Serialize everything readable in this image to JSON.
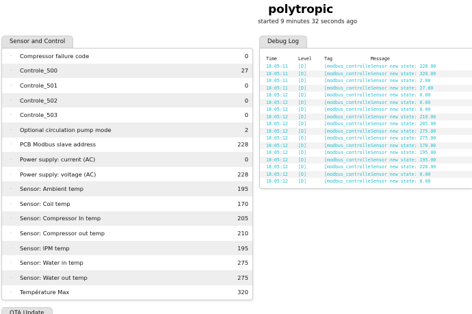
{
  "header": {
    "title": "polytropic",
    "subtitle": "started 9 minutes 32 seconds ago"
  },
  "sensor_panel": {
    "tab_label": "Sensor and Control",
    "rows": [
      {
        "label": "Compressor failure code",
        "value": "0"
      },
      {
        "label": "Controle_500",
        "value": "27"
      },
      {
        "label": "Controle_501",
        "value": "0"
      },
      {
        "label": "Controle_502",
        "value": "0"
      },
      {
        "label": "Controle_503",
        "value": "0"
      },
      {
        "label": "Optional circulation pump mode",
        "value": "2"
      },
      {
        "label": "PCB Modbus slave address",
        "value": "228"
      },
      {
        "label": "Power supply: current (AC)",
        "value": "0"
      },
      {
        "label": "Power supply: voltage (AC)",
        "value": "228"
      },
      {
        "label": "Sensor: Ambient temp",
        "value": "195"
      },
      {
        "label": "Sensor: Coil temp",
        "value": "170"
      },
      {
        "label": "Sensor: Compressor In temp",
        "value": "205"
      },
      {
        "label": "Sensor: Compressor out temp",
        "value": "210"
      },
      {
        "label": "Sensor: IPM temp",
        "value": "195"
      },
      {
        "label": "Sensor: Water in temp",
        "value": "275"
      },
      {
        "label": "Sensor: Water out temp",
        "value": "275"
      },
      {
        "label": "Température Max",
        "value": "320"
      }
    ]
  },
  "debug_panel": {
    "tab_label": "Debug Log",
    "columns": [
      "Time",
      "Level",
      "Tag",
      "Message"
    ],
    "entries": [
      {
        "time": "18:05:11",
        "level": "[D]",
        "tag": "[modbus_controller]",
        "message": "Sensor new state: 228.00"
      },
      {
        "time": "18:05:11",
        "level": "[D]",
        "tag": "[modbus_controller]",
        "message": "Sensor new state: 320.00"
      },
      {
        "time": "18:05:11",
        "level": "[D]",
        "tag": "[modbus_controller]",
        "message": "Sensor new state: 2.00"
      },
      {
        "time": "18:05:11",
        "level": "[D]",
        "tag": "[modbus_controller]",
        "message": "Sensor new state: 27.00"
      },
      {
        "time": "18:05:12",
        "level": "[D]",
        "tag": "[modbus_controller]",
        "message": "Sensor new state: 0.00"
      },
      {
        "time": "18:05:12",
        "level": "[D]",
        "tag": "[modbus_controller]",
        "message": "Sensor new state: 0.00"
      },
      {
        "time": "18:05:12",
        "level": "[D]",
        "tag": "[modbus_controller]",
        "message": "Sensor new state: 0.00"
      },
      {
        "time": "18:05:12",
        "level": "[D]",
        "tag": "[modbus_controller]",
        "message": "Sensor new state: 210.00"
      },
      {
        "time": "18:05:12",
        "level": "[D]",
        "tag": "[modbus_controller]",
        "message": "Sensor new state: 205.00"
      },
      {
        "time": "18:05:12",
        "level": "[D]",
        "tag": "[modbus_controller]",
        "message": "Sensor new state: 275.00"
      },
      {
        "time": "18:05:12",
        "level": "[D]",
        "tag": "[modbus_controller]",
        "message": "Sensor new state: 275.00"
      },
      {
        "time": "18:05:12",
        "level": "[D]",
        "tag": "[modbus_controller]",
        "message": "Sensor new state: 170.00"
      },
      {
        "time": "18:05:12",
        "level": "[D]",
        "tag": "[modbus_controller]",
        "message": "Sensor new state: 195.00"
      },
      {
        "time": "18:05:12",
        "level": "[D]",
        "tag": "[modbus_controller]",
        "message": "Sensor new state: 195.00"
      },
      {
        "time": "18:05:12",
        "level": "[D]",
        "tag": "[modbus_controller]",
        "message": "Sensor new state: 228.00"
      },
      {
        "time": "18:05:12",
        "level": "[D]",
        "tag": "[modbus_controller]",
        "message": "Sensor new state: 0.00"
      },
      {
        "time": "18:05:12",
        "level": "[D]",
        "tag": "[modbus_controller]",
        "message": "Sensor new state: 0.00"
      }
    ]
  },
  "ota_panel": {
    "tab_label": "OTA Update"
  },
  "colors": {
    "log_text": "#22bfd1",
    "tab_bg": "#e2e2e2",
    "row_stripe": "#eeeeee"
  }
}
